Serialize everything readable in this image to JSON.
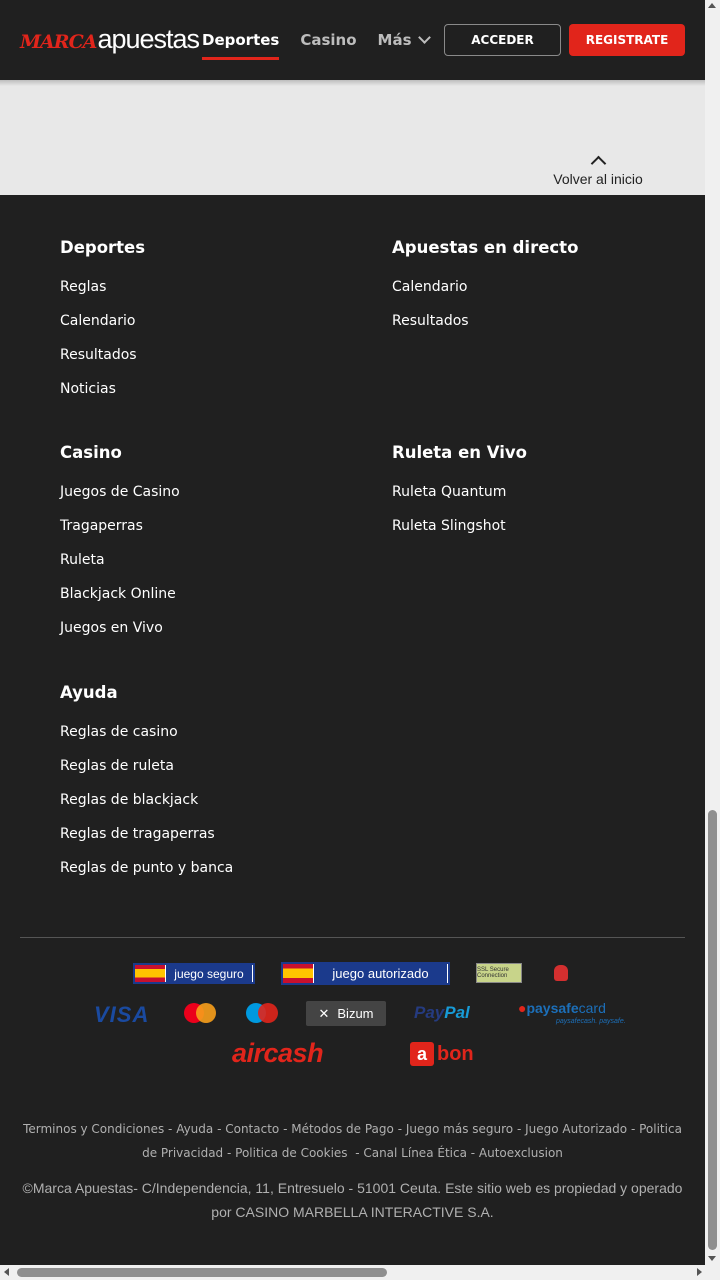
{
  "header": {
    "logo_marca": "MARCA",
    "logo_apuestas": "apuestas",
    "nav": [
      {
        "label": "Deportes",
        "active": true
      },
      {
        "label": "Casino",
        "active": false
      },
      {
        "label": "Más",
        "active": false
      }
    ],
    "acceder": "ACCEDER",
    "registrate": "REGISTRATE"
  },
  "back_to_top": "Volver al inicio",
  "footer": {
    "deportes": {
      "title": "Deportes",
      "links": [
        "Reglas",
        "Calendario",
        "Resultados",
        "Noticias"
      ]
    },
    "apuestas_directo": {
      "title": "Apuestas en directo",
      "links": [
        "Calendario",
        "Resultados"
      ]
    },
    "casino": {
      "title": "Casino",
      "links": [
        "Juegos de Casino",
        "Tragaperras",
        "Ruleta",
        "Blackjack Online",
        "Juegos en Vivo"
      ]
    },
    "ruleta_vivo": {
      "title": "Ruleta en Vivo",
      "links": [
        "Ruleta Quantum",
        "Ruleta Slingshot"
      ]
    },
    "ayuda": {
      "title": "Ayuda",
      "links": [
        "Reglas de casino",
        "Reglas de ruleta",
        "Reglas de blackjack",
        "Reglas de tragaperras",
        "Reglas de punto y banca"
      ]
    }
  },
  "badges": {
    "juego_seguro": "juego seguro",
    "juego_autorizado": "juego autorizado",
    "ssl": "SSL Secure Connection"
  },
  "payments": {
    "visa": "VISA",
    "bizum": "Bizum",
    "paypal_1": "Pay",
    "paypal_2": "Pal",
    "paysafe_1": "paysafe",
    "paysafe_2": "card",
    "paysafe_sub": "paysafecash. paysafe.",
    "aircash": "aircash",
    "abon_a": "a",
    "abon_bon": "bon"
  },
  "legal": {
    "links": [
      "Terminos y Condiciones",
      "Ayuda",
      "Contacto",
      "Métodos de Pago",
      "Juego más seguro",
      "Juego Autorizado",
      "Politica de Privacidad",
      "Politica de Cookies",
      "Canal Línea Ética",
      "Autoexclusion"
    ],
    "copyright_1": "©Marca Apuestas- C/Independencia, 11, Entresuelo - 51001 Ceuta. Este sitio web es propiedad y operado",
    "copyright_2": "por  CASINO MARBELLA INTERACTIVE S.A."
  },
  "colors": {
    "brand_red": "#e1251b",
    "footer_bg": "#202020",
    "band_bg": "#e8e8e8"
  }
}
